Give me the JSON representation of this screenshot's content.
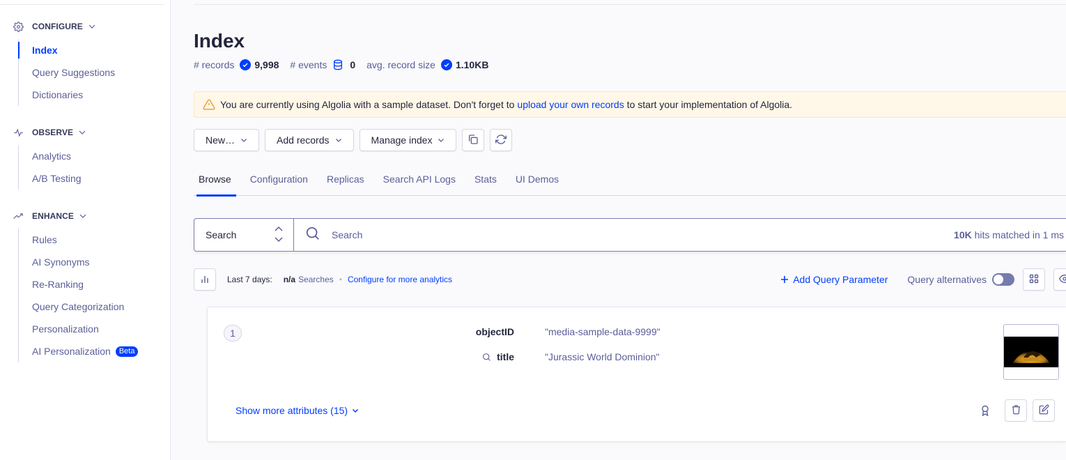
{
  "sidebar": {
    "sections": [
      {
        "label": "CONFIGURE",
        "icon": "gear-icon",
        "items": [
          {
            "label": "Index",
            "active": true
          },
          {
            "label": "Query Suggestions"
          },
          {
            "label": "Dictionaries"
          }
        ]
      },
      {
        "label": "OBSERVE",
        "icon": "activity-icon",
        "items": [
          {
            "label": "Analytics"
          },
          {
            "label": "A/B Testing"
          }
        ]
      },
      {
        "label": "ENHANCE",
        "icon": "trending-up-icon",
        "items": [
          {
            "label": "Rules"
          },
          {
            "label": "AI Synonyms"
          },
          {
            "label": "Re-Ranking"
          },
          {
            "label": "Query Categorization"
          },
          {
            "label": "Personalization"
          },
          {
            "label": "AI Personalization",
            "badge": "Beta"
          }
        ]
      }
    ]
  },
  "header": {
    "title": "Index",
    "stats": {
      "records_label": "# records",
      "records_value": "9,998",
      "events_label": "# events",
      "events_value": "0",
      "avg_size_label": "avg. record size",
      "avg_size_value": "1.10KB"
    }
  },
  "banner": {
    "text_before": "You are currently using Algolia with a sample dataset. Don't forget to",
    "link": "upload your own records",
    "text_after": "to start your implementation of Algolia."
  },
  "toolbar": {
    "new_label": "New…",
    "add_records_label": "Add records",
    "manage_index_label": "Manage index"
  },
  "tabs": [
    {
      "label": "Browse",
      "active": true
    },
    {
      "label": "Configuration"
    },
    {
      "label": "Replicas"
    },
    {
      "label": "Search API Logs"
    },
    {
      "label": "Stats"
    },
    {
      "label": "UI Demos"
    }
  ],
  "search": {
    "mode": "Search",
    "placeholder": "Search",
    "hits_count": "10K",
    "hits_text": "hits matched in 1 ms"
  },
  "analytics": {
    "period_label": "Last 7 days:",
    "searches_value": "n/a",
    "searches_label": "Searches",
    "configure_link": "Configure for more analytics",
    "add_param_label": "Add Query Parameter",
    "query_alternatives_label": "Query alternatives",
    "query_alternatives_on": false
  },
  "hits": [
    {
      "position": "1",
      "attributes": [
        {
          "key": "objectID",
          "value": "\"media-sample-data-9999\"",
          "searchable": false
        },
        {
          "key": "title",
          "value": "\"Jurassic World Dominion\"",
          "searchable": true
        }
      ],
      "show_more_label": "Show more attributes (15)"
    }
  ],
  "colors": {
    "accent": "#003dff",
    "text_primary": "#23263b",
    "text_secondary": "#5a5e9a",
    "warning_bg": "#fff7e8",
    "warning_icon": "#e8a33a"
  }
}
